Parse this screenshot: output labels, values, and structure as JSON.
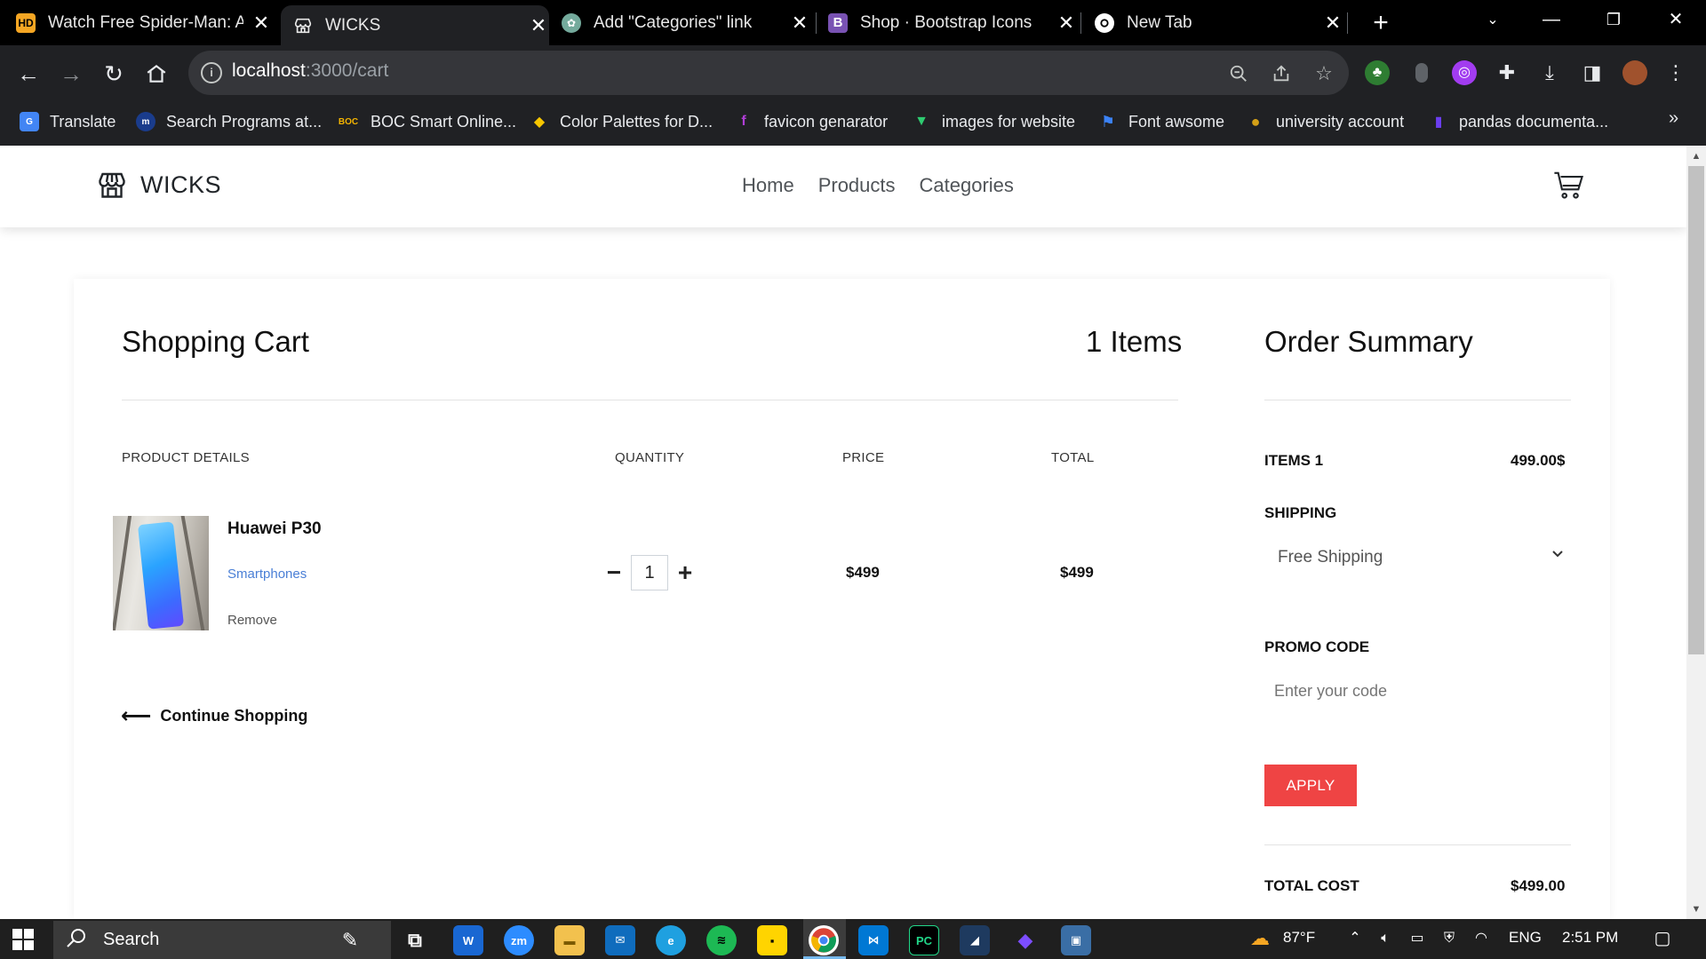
{
  "browser": {
    "tabs": [
      {
        "title": "Watch Free Spider-Man: A",
        "favicon": "hd-icon",
        "favicon_text": "HD",
        "favicon_color": "#f5a623"
      },
      {
        "title": "WICKS",
        "favicon": "shop-icon",
        "active": true
      },
      {
        "title": "Add \"Categories\" link",
        "favicon": "chatgpt-icon",
        "favicon_color": "#74aa9c"
      },
      {
        "title": "Shop · Bootstrap Icons",
        "favicon": "bootstrap-icon",
        "favicon_text": "B",
        "favicon_color": "#7952b3"
      },
      {
        "title": "New Tab",
        "favicon": "chrome-icon"
      }
    ],
    "address": {
      "host": "localhost",
      "path": ":3000/cart"
    },
    "bookmarks": [
      {
        "label": "Translate",
        "icon": "google-translate-icon",
        "color": "#4285f4",
        "text": "G"
      },
      {
        "label": "Search Programs at...",
        "icon": "university-icon",
        "color": "#1a3c8c",
        "text": "m"
      },
      {
        "label": "BOC Smart Online...",
        "icon": "boc-icon",
        "color": "#202124",
        "text": "BOC"
      },
      {
        "label": "Color Palettes for D...",
        "icon": "palette-icon",
        "color": "#f7c600",
        "text": "◆"
      },
      {
        "label": "favicon genarator",
        "icon": "favicon-icon",
        "color": "#b03ed6",
        "text": "f"
      },
      {
        "label": "images for website",
        "icon": "vector-icon",
        "color": "#2ecc71",
        "text": "▼"
      },
      {
        "label": "Font awsome",
        "icon": "flag-icon",
        "color": "#3b82f6",
        "text": "⚑"
      },
      {
        "label": "university account",
        "icon": "coin-icon",
        "color": "#d4a017",
        "text": "●"
      },
      {
        "label": "pandas documenta...",
        "icon": "pandas-icon",
        "color": "#150458",
        "text": "▮"
      }
    ]
  },
  "site": {
    "brand": "WICKS",
    "nav": [
      "Home",
      "Products",
      "Categories"
    ]
  },
  "cart": {
    "title": "Shopping Cart",
    "count_label": "1 Items",
    "columns": {
      "details": "PRODUCT DETAILS",
      "quantity": "QUANTITY",
      "price": "PRICE",
      "total": "TOTAL"
    },
    "items": [
      {
        "name": "Huawei P30",
        "category": "Smartphones",
        "remove": "Remove",
        "quantity": "1",
        "price": "$499",
        "total": "$499"
      }
    ],
    "continue_label": "Continue Shopping"
  },
  "summary": {
    "title": "Order Summary",
    "items_label": "ITEMS 1",
    "items_value": "499.00$",
    "shipping_label": "SHIPPING",
    "shipping_selected": "Free Shipping",
    "promo_label": "PROMO CODE",
    "promo_placeholder": "Enter your code",
    "apply_label": "APPLY",
    "total_label": "TOTAL COST",
    "total_value": "$499.00",
    "accent": "#ef4444"
  },
  "taskbar": {
    "search_label": "Search",
    "weather": "87°F",
    "language": "ENG",
    "time": "2:51 PM"
  }
}
